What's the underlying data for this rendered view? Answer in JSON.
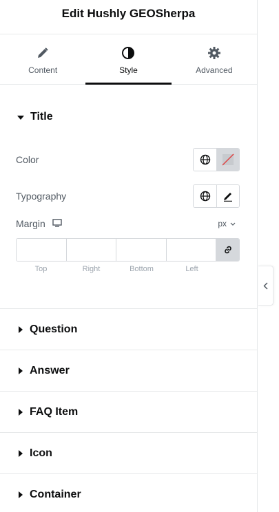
{
  "header": {
    "title": "Edit Hushly GEOSherpa"
  },
  "tabs": [
    {
      "label": "Content",
      "icon": "pencil-icon"
    },
    {
      "label": "Style",
      "icon": "contrast-icon",
      "active": true
    },
    {
      "label": "Advanced",
      "icon": "gear-icon"
    }
  ],
  "title_section": {
    "label": "Title",
    "color_label": "Color",
    "typography_label": "Typography",
    "margin_label": "Margin",
    "unit": "px",
    "dims": [
      "Top",
      "Right",
      "Bottom",
      "Left"
    ]
  },
  "collapsed_sections": [
    {
      "label": "Question"
    },
    {
      "label": "Answer"
    },
    {
      "label": "FAQ Item"
    },
    {
      "label": "Icon"
    },
    {
      "label": "Container"
    }
  ],
  "colors": {
    "text": "#0c0d0e",
    "muted": "#515962",
    "border": "#d5d8dc",
    "swatch_clear": "#e04141"
  }
}
